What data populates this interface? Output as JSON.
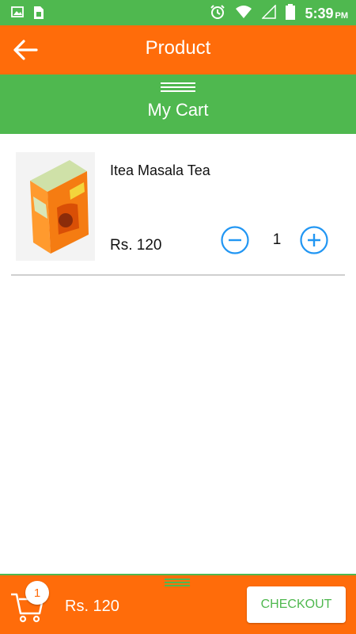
{
  "status_bar": {
    "time": "5:39",
    "ampm": "PM",
    "icons": [
      "image-icon",
      "sim-card-icon",
      "alarm-icon",
      "wifi-icon",
      "signal-icon",
      "battery-icon"
    ]
  },
  "app_bar": {
    "title": "Product"
  },
  "cart_header": {
    "title": "My Cart"
  },
  "cart": {
    "items": [
      {
        "name": "Itea Masala Tea",
        "price": "Rs. 120",
        "quantity": "1",
        "image_label": "itea"
      }
    ]
  },
  "bottom_bar": {
    "item_count": "1",
    "total": "Rs. 120",
    "checkout_label": "CHECKOUT"
  },
  "colors": {
    "primary_orange": "#ff6c0a",
    "primary_green": "#4fb84f",
    "accent_blue": "#2196f3"
  }
}
